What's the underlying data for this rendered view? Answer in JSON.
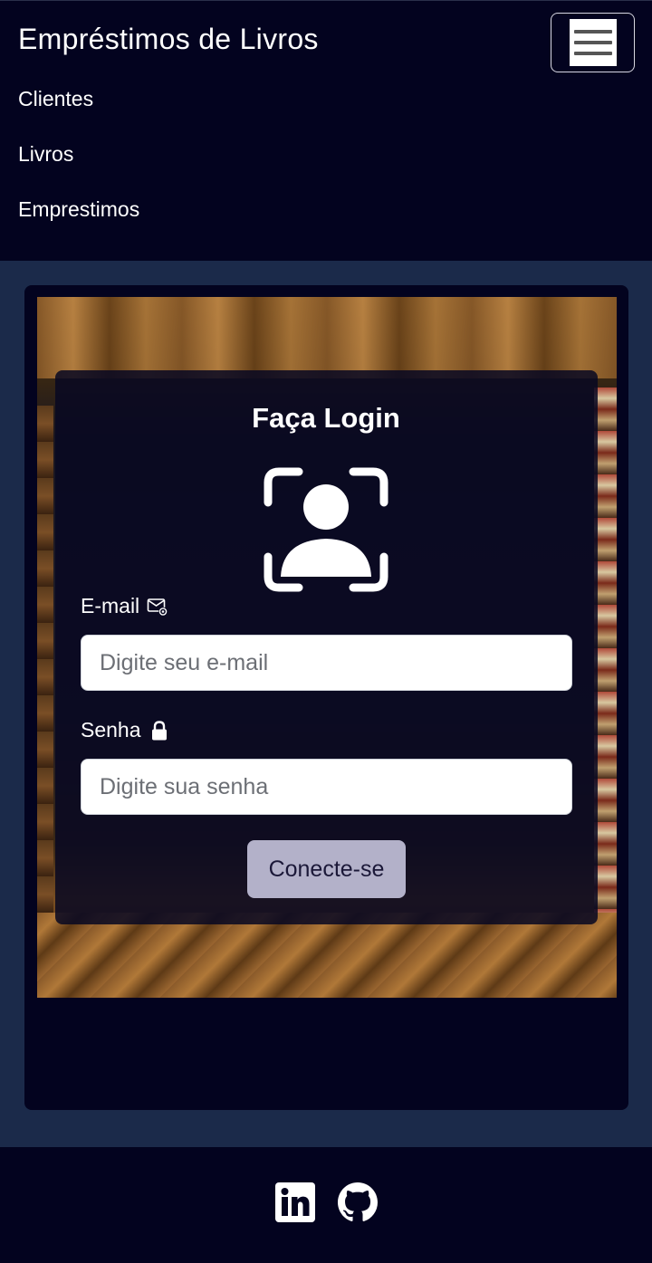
{
  "navbar": {
    "brand": "Empréstimos de Livros",
    "toggle_icon": "hamburger-menu-icon",
    "links": [
      {
        "label": "Clientes"
      },
      {
        "label": "Livros"
      },
      {
        "label": "Emprestimos"
      }
    ]
  },
  "login": {
    "title": "Faça Login",
    "avatar_icon": "user-scan-icon",
    "email": {
      "label": "E-mail",
      "icon": "envelope-at-icon",
      "placeholder": "Digite seu e-mail",
      "value": ""
    },
    "password": {
      "label": "Senha",
      "icon": "lock-icon",
      "placeholder": "Digite sua senha",
      "value": ""
    },
    "submit_label": "Conecte-se"
  },
  "footer": {
    "social": [
      {
        "icon": "linkedin-icon"
      },
      {
        "icon": "github-icon"
      }
    ]
  },
  "colors": {
    "navbar_bg": "#03031f",
    "page_bg": "#1b2a4a",
    "button_bg": "#b3b1c9"
  }
}
